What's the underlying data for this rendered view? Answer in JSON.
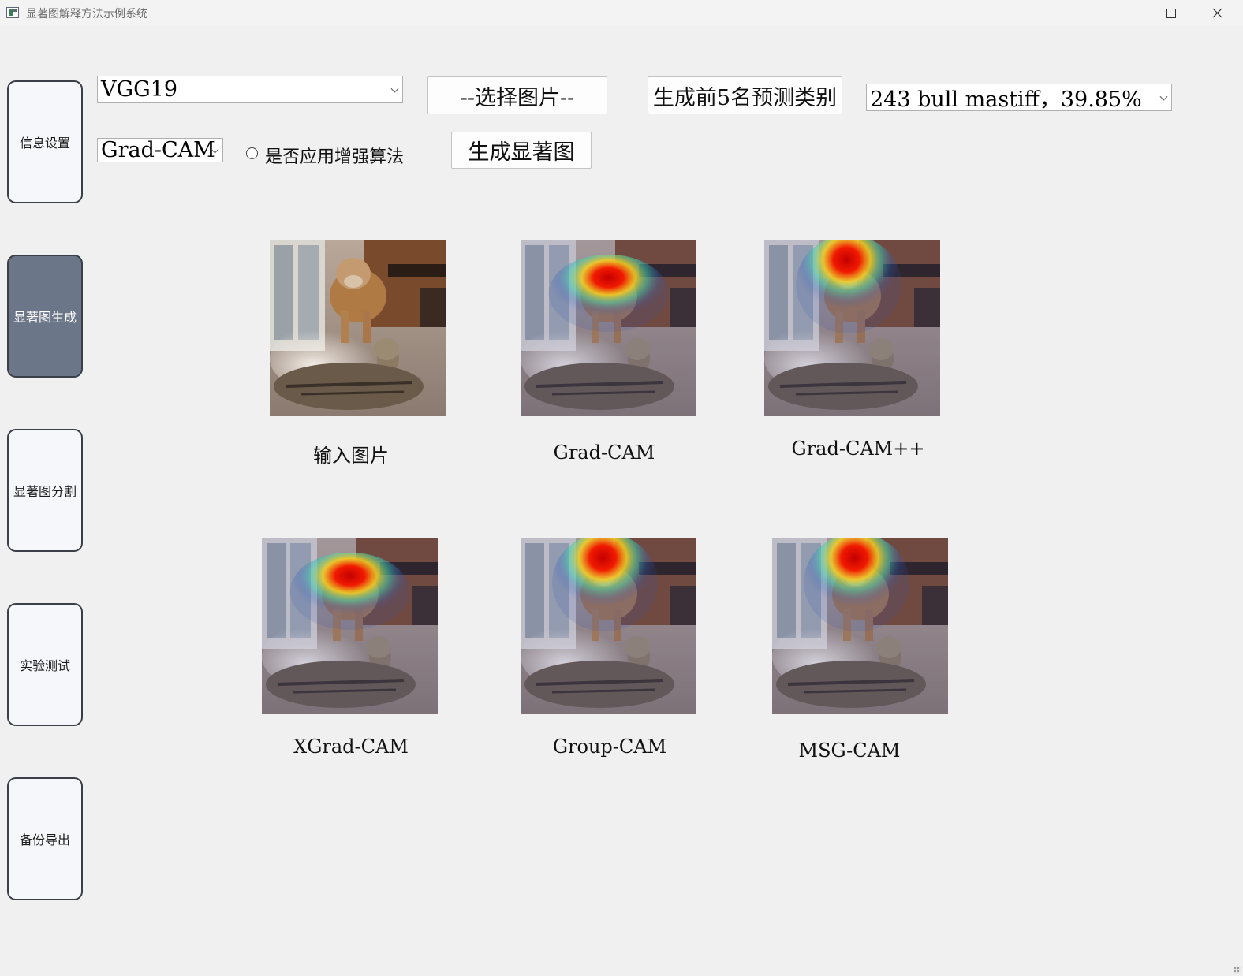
{
  "window": {
    "title": "显著图解释方法示例系统"
  },
  "nav": [
    {
      "label": "信息设置",
      "active": false
    },
    {
      "label": "显著图生成",
      "active": true
    },
    {
      "label": "显著图分割",
      "active": false
    },
    {
      "label": "实验测试",
      "active": false
    },
    {
      "label": "备份导出",
      "active": false
    }
  ],
  "controls": {
    "model_select": "VGG19",
    "select_image_label": "--选择图片--",
    "top5_label": "生成前5名预测类别",
    "prediction_select": "243 bull mastiff，39.85%",
    "method_select": "Grad-CAM",
    "enhance_label": "是否应用增强算法",
    "enhance_checked": false,
    "generate_label": "生成显著图"
  },
  "results": [
    {
      "caption": "输入图片",
      "heatmap": null
    },
    {
      "caption": "Grad-CAM",
      "heatmap": "wide"
    },
    {
      "caption": "Grad-CAM++",
      "heatmap": "round"
    },
    {
      "caption": "XGrad-CAM",
      "heatmap": "wide"
    },
    {
      "caption": "Group-CAM",
      "heatmap": "round"
    },
    {
      "caption": "MSG-CAM",
      "heatmap": "round"
    }
  ],
  "colors": {
    "active_nav": "#6b7689",
    "nav_border": "#3a3f48",
    "background": "#f0f0f0"
  }
}
